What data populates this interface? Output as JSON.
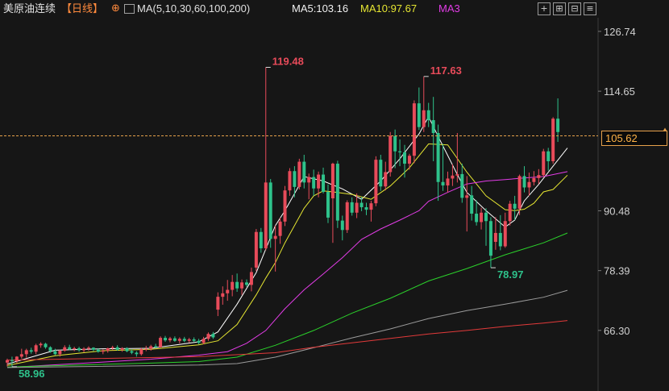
{
  "header": {
    "symbol": "美原油连续",
    "period": "【日线】",
    "ma_settings": "MA(5,10,30,60,100,200)",
    "ma5_label": "MA5:103.16",
    "ma10_label": "MA10:97.67",
    "ma30_label": "MA3"
  },
  "toolbar": {
    "buttons": [
      {
        "name": "crosshair-icon",
        "glyph": "+"
      },
      {
        "name": "zoom-in-icon",
        "glyph": "⊞"
      },
      {
        "name": "zoom-out-icon",
        "glyph": "⊟"
      },
      {
        "name": "menu-icon",
        "glyph": "≡"
      }
    ]
  },
  "current_price": "105.62",
  "colors": {
    "up": "#e84b5a",
    "down": "#2ec28b",
    "ma5": "#ffffff",
    "ma10": "#e6e632",
    "ma30": "#e23ce6",
    "ma60": "#2bd12b",
    "ma100": "#9b9b9b",
    "ma200": "#e23a3a",
    "current_line": "#e5a04a"
  },
  "chart_data": {
    "type": "candlestick",
    "ylim": [
      56.5,
      129.5
    ],
    "yticks": [
      "126.74",
      "114.65",
      "90.48",
      "78.39",
      "66.30"
    ],
    "current_price": 105.62,
    "annotations": [
      {
        "label": "119.48",
        "value": 119.48,
        "index": 54,
        "kind": "high"
      },
      {
        "label": "117.63",
        "value": 117.63,
        "index": 87,
        "kind": "high"
      },
      {
        "label": "78.97",
        "value": 78.97,
        "index": 101,
        "kind": "low"
      },
      {
        "label": "58.96",
        "value": 58.96,
        "index": 1,
        "kind": "low"
      }
    ],
    "candles": [
      [
        59.8,
        60.6,
        59.0,
        60.3
      ],
      [
        60.3,
        61.0,
        58.96,
        60.1
      ],
      [
        60.1,
        61.1,
        59.7,
        61.0
      ],
      [
        61.0,
        62.6,
        60.6,
        61.5
      ],
      [
        61.5,
        62.6,
        60.8,
        62.3
      ],
      [
        62.3,
        62.8,
        61.6,
        62.0
      ],
      [
        62.0,
        63.6,
        61.5,
        63.3
      ],
      [
        63.3,
        63.9,
        62.8,
        63.6
      ],
      [
        63.6,
        63.8,
        62.6,
        62.9
      ],
      [
        62.9,
        63.1,
        61.8,
        62.1
      ],
      [
        62.1,
        62.6,
        61.3,
        61.5
      ],
      [
        61.5,
        62.4,
        61.0,
        62.2
      ],
      [
        62.2,
        63.3,
        62.0,
        62.9
      ],
      [
        62.9,
        63.4,
        62.3,
        62.5
      ],
      [
        62.5,
        63.0,
        62.1,
        62.7
      ],
      [
        62.7,
        63.0,
        62.0,
        62.3
      ],
      [
        62.3,
        62.9,
        61.9,
        62.6
      ],
      [
        62.6,
        63.1,
        62.2,
        62.8
      ],
      [
        62.8,
        62.9,
        62.1,
        62.4
      ],
      [
        62.4,
        62.7,
        61.8,
        62.0
      ],
      [
        62.0,
        62.5,
        61.5,
        62.2
      ],
      [
        62.2,
        62.8,
        61.8,
        62.7
      ],
      [
        62.7,
        63.2,
        62.3,
        62.9
      ],
      [
        62.9,
        63.3,
        62.2,
        62.4
      ],
      [
        62.4,
        62.9,
        62.0,
        62.7
      ],
      [
        62.7,
        62.9,
        61.9,
        62.1
      ],
      [
        62.1,
        62.5,
        61.5,
        61.8
      ],
      [
        61.8,
        62.1,
        61.0,
        61.5
      ],
      [
        61.5,
        62.8,
        61.2,
        62.5
      ],
      [
        62.5,
        63.2,
        62.1,
        62.6
      ],
      [
        62.6,
        63.4,
        62.2,
        63.1
      ],
      [
        63.1,
        63.6,
        62.7,
        62.9
      ],
      [
        62.9,
        65.1,
        62.8,
        64.8
      ],
      [
        64.8,
        65.2,
        64.0,
        64.3
      ],
      [
        64.3,
        65.0,
        63.9,
        64.7
      ],
      [
        64.7,
        65.1,
        64.0,
        64.2
      ],
      [
        64.2,
        64.9,
        63.7,
        64.6
      ],
      [
        64.6,
        65.0,
        63.9,
        64.2
      ],
      [
        64.2,
        64.8,
        63.8,
        64.5
      ],
      [
        64.5,
        64.9,
        63.9,
        64.2
      ],
      [
        64.2,
        64.6,
        63.5,
        63.8
      ],
      [
        63.8,
        65.0,
        63.5,
        64.6
      ],
      [
        64.6,
        65.9,
        64.2,
        65.6
      ],
      [
        65.6,
        66.0,
        64.6,
        64.9
      ],
      [
        70.5,
        74.0,
        69.2,
        73.1
      ],
      [
        73.1,
        75.2,
        71.5,
        73.8
      ],
      [
        73.8,
        76.5,
        72.3,
        74.5
      ],
      [
        74.5,
        77.5,
        73.2,
        76.1
      ],
      [
        76.1,
        77.8,
        74.1,
        74.8
      ],
      [
        74.8,
        76.6,
        73.5,
        76.0
      ],
      [
        76.0,
        76.6,
        75.1,
        75.5
      ],
      [
        75.5,
        79.0,
        74.2,
        78.1
      ],
      [
        79.0,
        86.8,
        78.3,
        86.2
      ],
      [
        86.2,
        87.0,
        82.0,
        82.9
      ],
      [
        82.9,
        119.48,
        82.5,
        96.2
      ],
      [
        96.2,
        96.9,
        83.0,
        84.8
      ],
      [
        84.8,
        87.5,
        78.2,
        85.4
      ],
      [
        85.4,
        89.1,
        83.8,
        88.3
      ],
      [
        88.3,
        95.5,
        87.4,
        94.6
      ],
      [
        94.6,
        99.1,
        93.5,
        98.5
      ],
      [
        98.5,
        99.5,
        93.2,
        95.3
      ],
      [
        95.3,
        101.0,
        94.8,
        100.4
      ],
      [
        100.4,
        101.8,
        95.0,
        96.2
      ],
      [
        96.2,
        98.0,
        92.8,
        97.3
      ],
      [
        97.3,
        98.8,
        93.5,
        95.0
      ],
      [
        95.0,
        98.4,
        93.2,
        97.8
      ],
      [
        97.8,
        99.2,
        94.0,
        94.3
      ],
      [
        94.3,
        95.8,
        88.0,
        89.1
      ],
      [
        93.0,
        100.2,
        84.0,
        100.0
      ],
      [
        100.0,
        100.6,
        87.0,
        88.5
      ],
      [
        88.5,
        89.5,
        84.5,
        86.6
      ],
      [
        86.6,
        92.6,
        86.0,
        92.2
      ],
      [
        92.2,
        93.2,
        89.5,
        90.1
      ],
      [
        90.1,
        94.0,
        89.0,
        92.1
      ],
      [
        92.1,
        93.3,
        90.4,
        91.2
      ],
      [
        91.2,
        92.1,
        89.6,
        90.7
      ],
      [
        90.7,
        92.5,
        88.3,
        92.0
      ],
      [
        92.0,
        101.5,
        91.4,
        100.8
      ],
      [
        100.8,
        101.8,
        94.5,
        95.4
      ],
      [
        95.4,
        100.4,
        94.6,
        98.3
      ],
      [
        98.3,
        106.4,
        97.4,
        105.6
      ],
      [
        105.6,
        106.9,
        99.1,
        102.5
      ],
      [
        102.5,
        104.9,
        99.5,
        102.3
      ],
      [
        102.3,
        103.8,
        97.2,
        100.0
      ],
      [
        100.0,
        102.0,
        98.8,
        101.6
      ],
      [
        101.6,
        112.8,
        100.1,
        112.2
      ],
      [
        112.2,
        115.4,
        106.8,
        107.4
      ],
      [
        107.4,
        117.63,
        106.4,
        110.8
      ],
      [
        110.8,
        112.3,
        107.4,
        108.8
      ],
      [
        108.8,
        113.5,
        100.5,
        106.2
      ],
      [
        106.2,
        107.9,
        92.5,
        96.3
      ],
      [
        96.3,
        104.0,
        94.5,
        95.6
      ],
      [
        95.6,
        98.4,
        94.2,
        97.0
      ],
      [
        97.0,
        99.9,
        95.5,
        97.6
      ],
      [
        97.6,
        106.2,
        96.2,
        97.9
      ],
      [
        97.9,
        100.0,
        92.1,
        93.1
      ],
      [
        93.1,
        97.5,
        86.3,
        93.6
      ],
      [
        93.6,
        95.5,
        88.5,
        89.9
      ],
      [
        89.9,
        92.6,
        87.5,
        88.2
      ],
      [
        88.2,
        91.1,
        86.7,
        90.1
      ],
      [
        90.1,
        91.0,
        83.4,
        88.4
      ],
      [
        88.4,
        89.2,
        78.97,
        81.4
      ],
      [
        84.2,
        89.2,
        82.6,
        86.0
      ],
      [
        86.0,
        89.6,
        82.5,
        83.3
      ],
      [
        83.3,
        90.1,
        83.0,
        88.4
      ],
      [
        88.4,
        92.5,
        87.5,
        91.9
      ],
      [
        91.9,
        93.5,
        88.6,
        90.9
      ],
      [
        90.9,
        97.8,
        89.6,
        97.5
      ],
      [
        97.5,
        99.5,
        94.2,
        95.2
      ],
      [
        95.2,
        98.2,
        93.5,
        96.3
      ],
      [
        96.3,
        98.5,
        95.6,
        97.1
      ],
      [
        97.1,
        98.9,
        95.9,
        97.7
      ],
      [
        97.7,
        103.0,
        97.3,
        102.5
      ],
      [
        102.5,
        103.2,
        98.6,
        100.5
      ],
      [
        100.5,
        109.4,
        100.0,
        109.1
      ],
      [
        109.1,
        113.2,
        104.4,
        106.4
      ]
    ],
    "ma": {
      "ma5": {
        "points": [
          [
            0,
            59.5
          ],
          [
            10,
            62.3
          ],
          [
            20,
            62.6
          ],
          [
            30,
            62.7
          ],
          [
            40,
            64.0
          ],
          [
            44,
            66.0
          ],
          [
            48,
            71.6
          ],
          [
            52,
            78.0
          ],
          [
            56,
            87.5
          ],
          [
            58,
            90.5
          ],
          [
            62,
            97.4
          ],
          [
            66,
            96.5
          ],
          [
            70,
            94.9
          ],
          [
            74,
            92.8
          ],
          [
            78,
            96.5
          ],
          [
            82,
            101.0
          ],
          [
            86,
            106.0
          ],
          [
            88,
            109.5
          ],
          [
            90,
            105.5
          ],
          [
            94,
            97.8
          ],
          [
            96,
            94.2
          ],
          [
            100,
            90.5
          ],
          [
            104,
            87.2
          ],
          [
            106,
            88.6
          ],
          [
            108,
            92.5
          ],
          [
            111,
            95.8
          ],
          [
            114,
            99.5
          ],
          [
            117,
            103.16
          ]
        ]
      },
      "ma10": {
        "points": [
          [
            0,
            59.2
          ],
          [
            10,
            61.2
          ],
          [
            20,
            62.2
          ],
          [
            30,
            62.5
          ],
          [
            40,
            63.4
          ],
          [
            44,
            64.2
          ],
          [
            48,
            67.5
          ],
          [
            52,
            73.5
          ],
          [
            54,
            76.9
          ],
          [
            56,
            80.0
          ],
          [
            58,
            84.0
          ],
          [
            62,
            91.0
          ],
          [
            64,
            93.5
          ],
          [
            66,
            94.5
          ],
          [
            68,
            94.3
          ],
          [
            72,
            93.8
          ],
          [
            76,
            92.8
          ],
          [
            80,
            95.5
          ],
          [
            84,
            99.2
          ],
          [
            88,
            104.0
          ],
          [
            92,
            103.8
          ],
          [
            96,
            98.3
          ],
          [
            100,
            93.5
          ],
          [
            104,
            90.7
          ],
          [
            106,
            90.5
          ],
          [
            108,
            90.8
          ],
          [
            110,
            92.0
          ],
          [
            112,
            94.3
          ],
          [
            114,
            94.8
          ],
          [
            117,
            97.67
          ]
        ]
      },
      "ma30": {
        "points": [
          [
            0,
            58.8
          ],
          [
            20,
            59.9
          ],
          [
            30,
            60.5
          ],
          [
            40,
            61.3
          ],
          [
            46,
            62.0
          ],
          [
            50,
            63.7
          ],
          [
            54,
            66.3
          ],
          [
            58,
            70.7
          ],
          [
            62,
            74.5
          ],
          [
            66,
            77.7
          ],
          [
            70,
            81.0
          ],
          [
            74,
            84.7
          ],
          [
            78,
            86.8
          ],
          [
            82,
            88.6
          ],
          [
            86,
            90.5
          ],
          [
            88,
            92.4
          ],
          [
            92,
            94.2
          ],
          [
            96,
            95.9
          ],
          [
            100,
            96.5
          ],
          [
            104,
            96.8
          ],
          [
            108,
            97.1
          ],
          [
            112,
            97.4
          ],
          [
            117,
            98.4
          ]
        ]
      },
      "ma60": {
        "points": [
          [
            0,
            58.9
          ],
          [
            30,
            59.7
          ],
          [
            40,
            60.0
          ],
          [
            48,
            60.9
          ],
          [
            56,
            63.3
          ],
          [
            64,
            66.3
          ],
          [
            72,
            69.8
          ],
          [
            80,
            72.8
          ],
          [
            88,
            76.3
          ],
          [
            96,
            78.8
          ],
          [
            104,
            81.6
          ],
          [
            112,
            84.0
          ],
          [
            117,
            86.0
          ]
        ]
      },
      "ma100": {
        "points": [
          [
            0,
            58.8
          ],
          [
            40,
            59.3
          ],
          [
            48,
            59.6
          ],
          [
            56,
            60.9
          ],
          [
            64,
            62.8
          ],
          [
            72,
            64.8
          ],
          [
            80,
            66.6
          ],
          [
            88,
            68.7
          ],
          [
            96,
            70.3
          ],
          [
            104,
            71.6
          ],
          [
            112,
            73.0
          ],
          [
            117,
            74.4
          ]
        ]
      },
      "ma200": {
        "points": [
          [
            0,
            60.3
          ],
          [
            40,
            61.0
          ],
          [
            56,
            61.8
          ],
          [
            64,
            62.9
          ],
          [
            72,
            63.8
          ],
          [
            80,
            64.7
          ],
          [
            88,
            65.6
          ],
          [
            96,
            66.3
          ],
          [
            104,
            67.1
          ],
          [
            112,
            67.8
          ],
          [
            117,
            68.3
          ]
        ]
      }
    }
  }
}
